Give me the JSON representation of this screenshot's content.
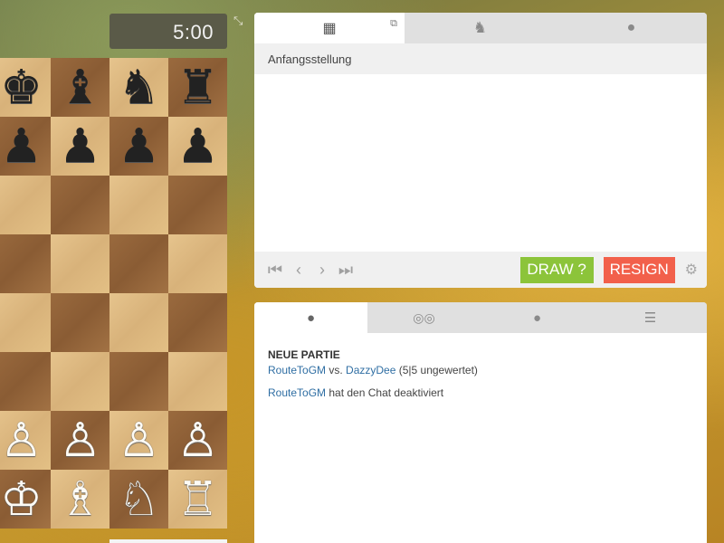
{
  "clock": {
    "time": "5:00"
  },
  "board": {
    "rows": [
      [
        {
          "p": "♚",
          "c": "black",
          "name": "black-king"
        },
        {
          "p": "♝",
          "c": "black",
          "name": "black-bishop"
        },
        {
          "p": "♞",
          "c": "black",
          "name": "black-knight"
        },
        {
          "p": "♜",
          "c": "black",
          "name": "black-rook"
        }
      ],
      [
        {
          "p": "♟",
          "c": "black",
          "name": "black-pawn"
        },
        {
          "p": "♟",
          "c": "black",
          "name": "black-pawn"
        },
        {
          "p": "♟",
          "c": "black",
          "name": "black-pawn"
        },
        {
          "p": "♟",
          "c": "black",
          "name": "black-pawn"
        }
      ],
      [
        null,
        null,
        null,
        null
      ],
      [
        null,
        null,
        null,
        null
      ],
      [
        null,
        null,
        null,
        null
      ],
      [
        null,
        null,
        null,
        null
      ],
      [
        {
          "p": "♙",
          "c": "white",
          "name": "white-pawn"
        },
        {
          "p": "♙",
          "c": "white",
          "name": "white-pawn"
        },
        {
          "p": "♙",
          "c": "white",
          "name": "white-pawn"
        },
        {
          "p": "♙",
          "c": "white",
          "name": "white-pawn"
        }
      ],
      [
        {
          "p": "♔",
          "c": "white",
          "name": "white-king"
        },
        {
          "p": "♗",
          "c": "white",
          "name": "white-bishop"
        },
        {
          "p": "♘",
          "c": "white",
          "name": "white-knight"
        },
        {
          "p": "♖",
          "c": "white",
          "name": "white-rook"
        }
      ]
    ]
  },
  "game_panel": {
    "tabs": [
      {
        "icon": "board-icon",
        "glyph": "▦"
      },
      {
        "icon": "analysis-icon",
        "glyph": "♞"
      },
      {
        "icon": "medal-icon",
        "glyph": "🏅"
      }
    ],
    "popout_icon": "external-link-icon",
    "opening": "Anfangsstellung",
    "nav": {
      "first": "|‹",
      "prev": "‹",
      "next": "›",
      "last": "›|"
    },
    "draw_label": "DRAW ?",
    "resign_label": "RESIGN",
    "settings_icon": "gear-icon"
  },
  "chat_panel": {
    "tabs": [
      {
        "icon": "chat-bubble-icon",
        "glyph": "💬"
      },
      {
        "icon": "binoculars-icon",
        "glyph": "👁"
      },
      {
        "icon": "group-chat-icon",
        "glyph": "💭"
      },
      {
        "icon": "list-icon",
        "glyph": "☰"
      }
    ],
    "title": "NEUE PARTIE",
    "player1": "RouteToGM",
    "vs": " vs. ",
    "player2": "DazzyDee",
    "game_info": " (5|5 ungewertet)",
    "message_player": "RouteToGM",
    "message_text": " hat den Chat deaktiviert"
  },
  "colors": {
    "draw": "#8cc43a",
    "resign": "#f2604b",
    "player_link": "#2f6ea3"
  }
}
